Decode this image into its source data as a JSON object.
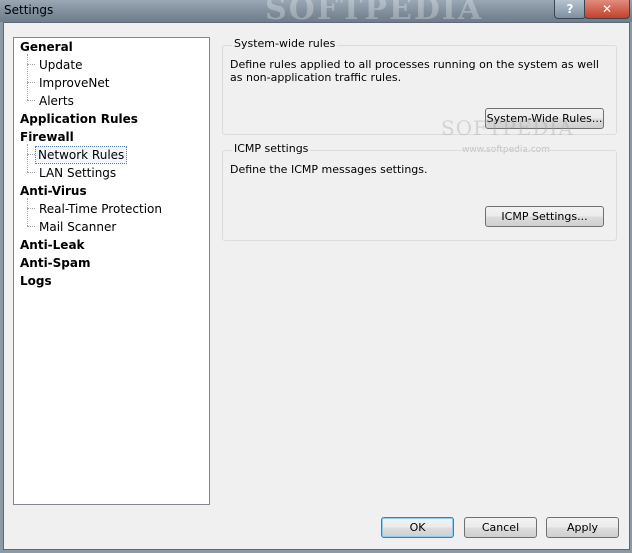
{
  "window": {
    "title": "Settings",
    "watermark": "SOFTPEDIA",
    "help_label": "?",
    "close_label": "✕"
  },
  "tree": {
    "items": [
      {
        "label": "General",
        "bold": true
      },
      {
        "label": "Update",
        "bold": false
      },
      {
        "label": "ImproveNet",
        "bold": false
      },
      {
        "label": "Alerts",
        "bold": false
      },
      {
        "label": "Application Rules",
        "bold": true
      },
      {
        "label": "Firewall",
        "bold": true
      },
      {
        "label": "Network Rules",
        "bold": false,
        "selected": true
      },
      {
        "label": "LAN Settings",
        "bold": false
      },
      {
        "label": "Anti-Virus",
        "bold": true
      },
      {
        "label": "Real-Time Protection",
        "bold": false
      },
      {
        "label": "Mail Scanner",
        "bold": false
      },
      {
        "label": "Anti-Leak",
        "bold": true
      },
      {
        "label": "Anti-Spam",
        "bold": true
      },
      {
        "label": "Logs",
        "bold": true
      }
    ]
  },
  "system_wide": {
    "title": "System-wide rules",
    "description": "Define rules applied to all processes running on the system as well as non-application traffic rules.",
    "button": "System-Wide Rules..."
  },
  "icmp": {
    "title": "ICMP settings",
    "description": "Define the ICMP messages settings.",
    "button": "ICMP Settings..."
  },
  "content_watermark": "SOFTPEDIA",
  "content_watermark_url": "www.softpedia.com",
  "footer": {
    "ok": "OK",
    "cancel": "Cancel",
    "apply": "Apply"
  }
}
